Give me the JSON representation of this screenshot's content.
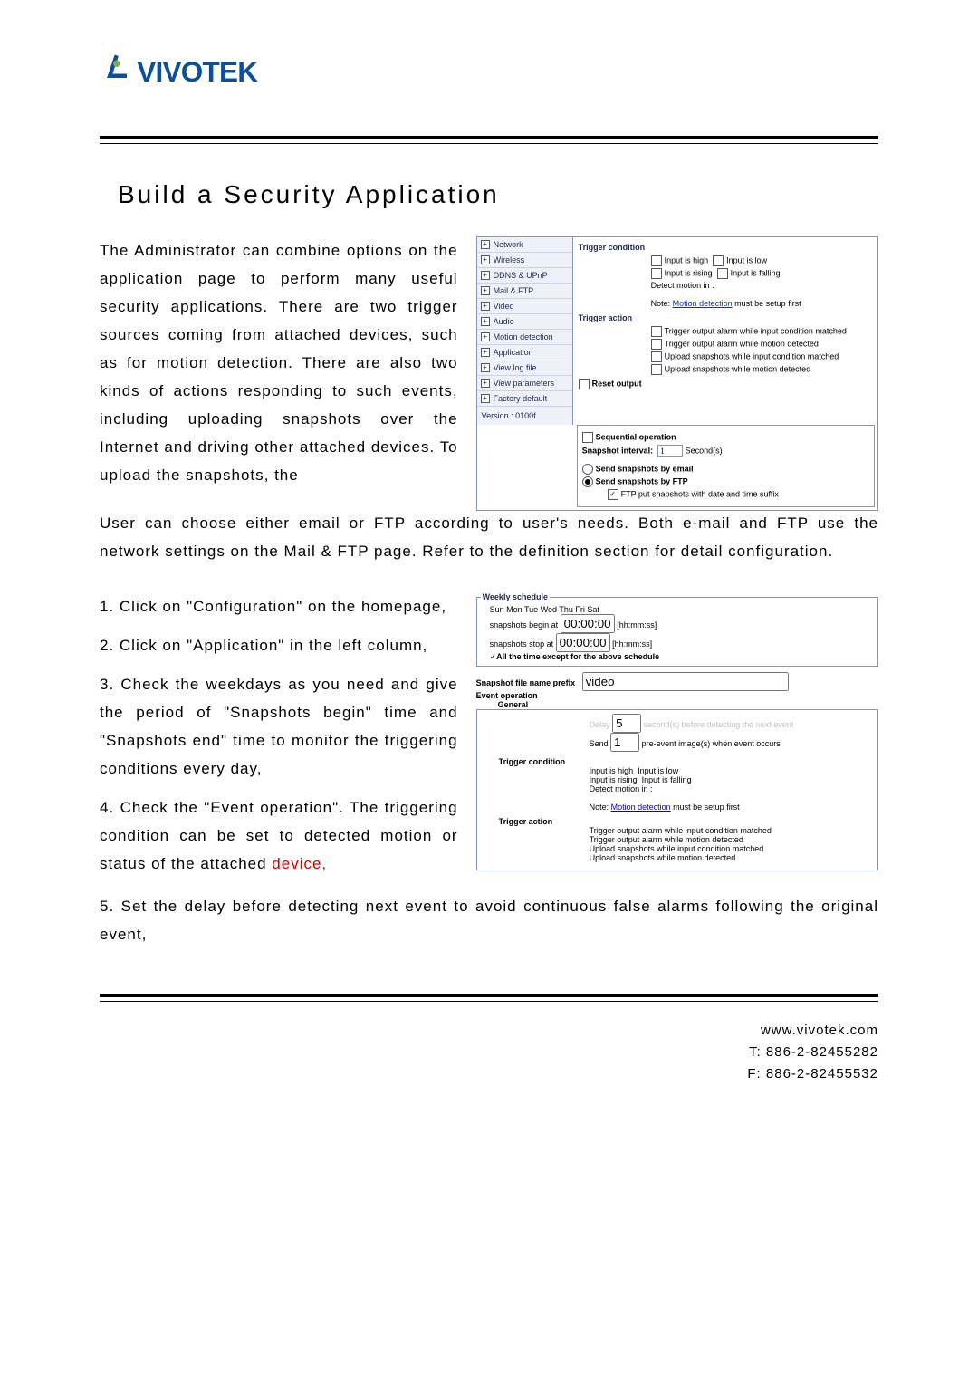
{
  "logo_text": "VIVOTEK",
  "title": "Build a Security Application",
  "para1_left": "The Administrator can combine options on the application page to perform many useful security applications. There are two trigger sources coming from attached devices, such as for motion detection. There are also two kinds of actions responding to such events, including uploading snapshots over the Internet and driving other attached devices. To upload the snapshots, the",
  "para1_below": "User can choose either email or FTP according to user's needs. Both e-mail and FTP use the network settings on the Mail & FTP page. Refer to the definition section for detail configuration.",
  "step1": "1.  Click  on  \"Configuration\"  on  the homepage,",
  "step2": "2.  Click  on  \"Application\"  in  the  left column,",
  "step3": "3. Check the weekdays as you need and give the period of \"Snapshots begin\" time and \"Snapshots end\" time to monitor the triggering conditions every day,",
  "step4a": "4. Check the \"Event operation\". The triggering condition can be set to detected motion or status of the attached ",
  "step4b": "device,",
  "step5": "5. Set the delay before detecting next event to avoid continuous false alarms following the original event,",
  "panel1": {
    "nav": [
      "Network",
      "Wireless",
      "DDNS & UPnP",
      "Mail & FTP",
      "Video",
      "Audio",
      "Motion detection",
      "Application",
      "View log file",
      "View parameters",
      "Factory default"
    ],
    "version": "Version : 0100f",
    "tc_head": "Trigger condition",
    "tc_high": "Input is high",
    "tc_low": "Input is low",
    "tc_rising": "Input is rising",
    "tc_falling": "Input is falling",
    "detect_in": "Detect motion in :",
    "note_pref": "Note: ",
    "note_link": "Motion detection",
    "note_suf": " must be setup first",
    "ta_head": "Trigger action",
    "ta1": "Trigger output alarm while input condition matched",
    "ta2": "Trigger output alarm while motion detected",
    "ta3": "Upload snapshots while input condition matched",
    "ta4": "Upload snapshots while motion detected",
    "reset_out": "Reset output",
    "seq_op": "Sequential operation",
    "snap_interval_lbl": "Snapshot interval:",
    "snap_interval_val": "1",
    "seconds": "Second(s)",
    "send_email": "Send snapshots by email",
    "send_ftp": "Send snapshots by FTP",
    "ftp_suffix": "FTP put snapshots with date and time suffix"
  },
  "panel2": {
    "wk_head": "Weekly schedule",
    "days": [
      "Sun",
      "Mon",
      "Tue",
      "Wed",
      "Thu",
      "Fri",
      "Sat"
    ],
    "begin_lbl": "snapshots begin at",
    "begin_val": "00:00:00",
    "stop_lbl": "snapshots stop at",
    "stop_val": "00:00:00",
    "hhmmss": "[hh:mm:ss]",
    "all_time": "All the time except for the above schedule",
    "prefix_lbl": "Snapshot file name prefix",
    "prefix_val": "video",
    "event_op": "Event operation",
    "general": "General",
    "delay_lbl": "Delay",
    "delay_val": "5",
    "delay_txt": "second(s) before detecting the next event",
    "send_lbl": "Send",
    "send_val": "1",
    "send_txt": "pre-event image(s) when event occurs",
    "tc_head": "Trigger condition",
    "tc_high": "Input is high",
    "tc_low": "Input is low",
    "tc_rising": "Input is rising",
    "tc_falling": "Input is falling",
    "detect_in": "Detect motion in :",
    "note_pref": "Note: ",
    "note_link": "Motion detection",
    "note_suf": " must be setup first",
    "ta_head": "Trigger action",
    "ta1": "Trigger output alarm while input condition matched",
    "ta2": "Trigger output alarm while motion detected",
    "ta3": "Upload snapshots while input condition matched",
    "ta4": "Upload snapshots while motion detected"
  },
  "footer": {
    "url": "www.vivotek.com",
    "tel": "T: 886-2-82455282",
    "fax": "F: 886-2-82455532"
  }
}
